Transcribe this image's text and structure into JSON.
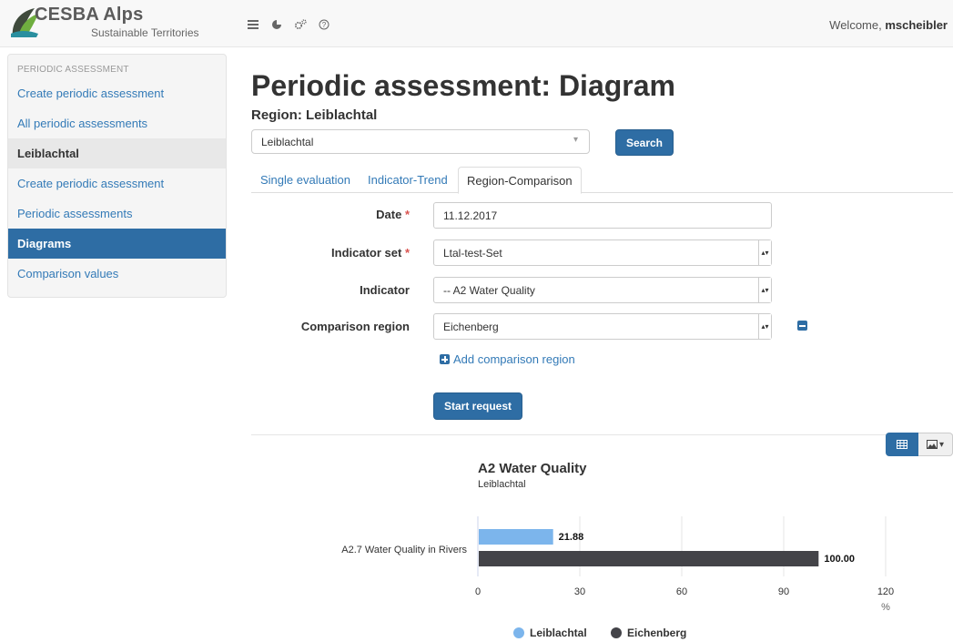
{
  "brand": {
    "title": "CESBA Alps",
    "subtitle": "Sustainable Territories",
    "colors": {
      "green": "#6fae3f",
      "teal": "#2a8f9f",
      "dark": "#3f4a3c"
    }
  },
  "navbar": {
    "icons": [
      "list-icon",
      "pie-chart-icon",
      "cogs-icon",
      "help-icon"
    ],
    "welcome_prefix": "Welcome, ",
    "username": "mscheibler"
  },
  "sidebar": {
    "header": "PERIODIC ASSESSMENT",
    "items": [
      {
        "label": "Create periodic assessment",
        "kind": "link"
      },
      {
        "label": "All periodic assessments",
        "kind": "link"
      },
      {
        "label": "Leiblachtal",
        "kind": "group"
      },
      {
        "label": "Create periodic assessment",
        "kind": "link"
      },
      {
        "label": "Periodic assessments",
        "kind": "link"
      },
      {
        "label": "Diagrams",
        "kind": "active"
      },
      {
        "label": "Comparison values",
        "kind": "link"
      }
    ]
  },
  "main": {
    "title": "Periodic assessment: Diagram",
    "region_label": "Region: Leiblachtal",
    "region_value": "Leiblachtal",
    "search_label": "Search",
    "tabs": [
      {
        "label": "Single evaluation",
        "active": false
      },
      {
        "label": "Indicator-Trend",
        "active": false
      },
      {
        "label": "Region-Comparison",
        "active": true
      }
    ],
    "form": {
      "date_label": "Date",
      "date_value": "11.12.2017",
      "indicator_set_label": "Indicator set",
      "indicator_set_value": "Ltal-test-Set",
      "indicator_label": "Indicator",
      "indicator_value": "-- A2 Water Quality",
      "comparison_label": "Comparison region",
      "comparison_value": "Eichenberg",
      "required_mark": "*",
      "add_comparison_label": "Add comparison region",
      "start_label": "Start request"
    }
  },
  "chart_data": {
    "type": "bar",
    "orientation": "horizontal",
    "title": "A2 Water Quality",
    "subtitle": "Leiblachtal",
    "categories": [
      "A2.7 Water Quality in Rivers"
    ],
    "series": [
      {
        "name": "Leiblachtal",
        "values": [
          21.88
        ],
        "color": "#7cb5ec"
      },
      {
        "name": "Eichenberg",
        "values": [
          100.0
        ],
        "color": "#434348"
      }
    ],
    "value_labels": [
      "21.88",
      "100.00"
    ],
    "x_ticks": [
      "0",
      "30",
      "60",
      "90",
      "120"
    ],
    "xlim": [
      0,
      120
    ],
    "unit": "%",
    "grid": true,
    "legend": "bottom-center"
  }
}
